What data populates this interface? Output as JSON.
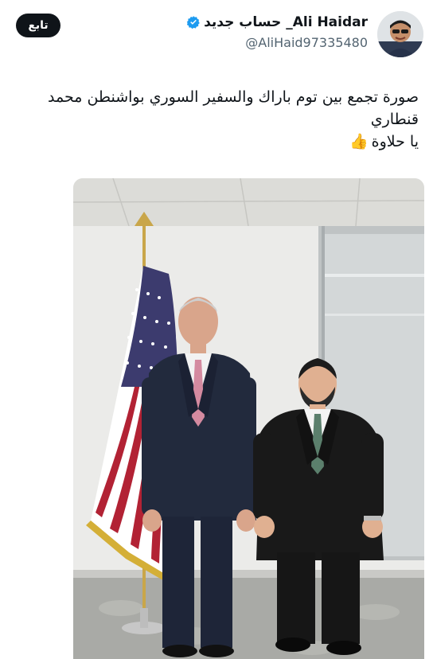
{
  "header": {
    "follow_label": "تابع",
    "display_name": "Ali Haidar_ حساب جديد",
    "handle": "@AliHaid97335480"
  },
  "tweet": {
    "line1": "صورة تجمع بين توم باراك والسفير السوري بواشنطن محمد",
    "line2": "قنطاري",
    "line3": "يا حلاوة",
    "emoji": "👍"
  },
  "colors": {
    "verified": "#1d9bf0",
    "follow_button": "#0f1419",
    "handle": "#536471"
  },
  "icons": [
    "verified-badge-icon",
    "thumbs-up-emoji"
  ]
}
